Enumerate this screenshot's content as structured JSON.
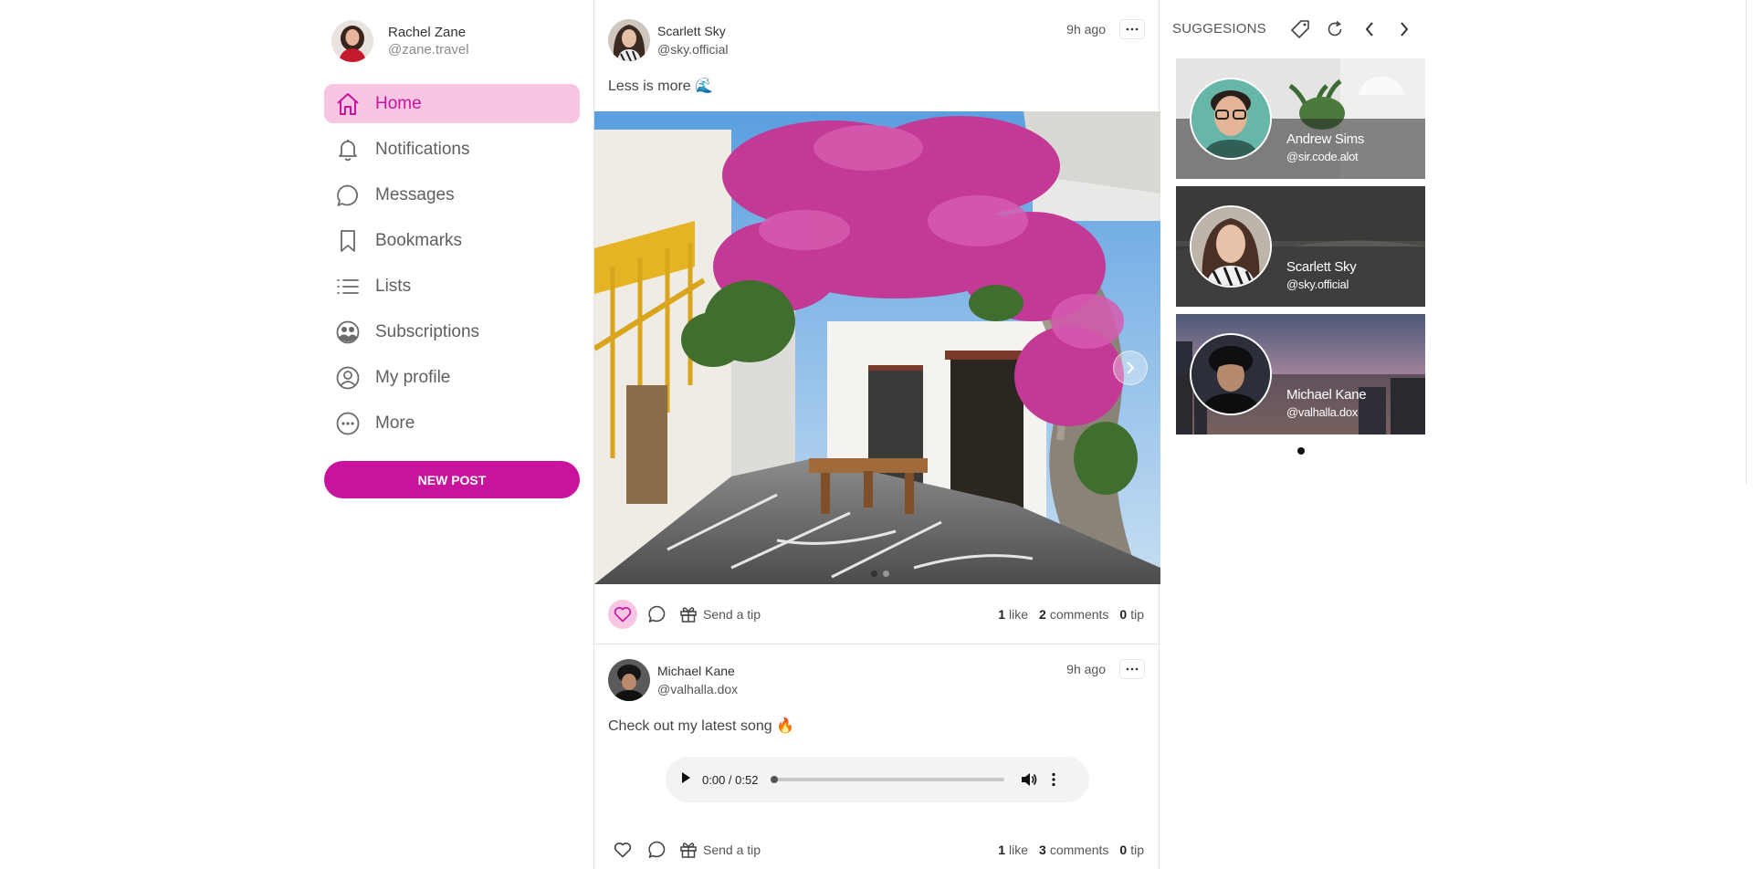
{
  "user": {
    "name": "Rachel Zane",
    "handle": "@zane.travel"
  },
  "nav": {
    "items": [
      {
        "label": "Home",
        "icon": "home-icon",
        "active": true
      },
      {
        "label": "Notifications",
        "icon": "bell-icon",
        "active": false
      },
      {
        "label": "Messages",
        "icon": "chat-bubble-icon",
        "active": false
      },
      {
        "label": "Bookmarks",
        "icon": "bookmark-icon",
        "active": false
      },
      {
        "label": "Lists",
        "icon": "list-icon",
        "active": false
      },
      {
        "label": "Subscriptions",
        "icon": "subscriptions-icon",
        "active": false
      },
      {
        "label": "My profile",
        "icon": "user-circle-icon",
        "active": false
      },
      {
        "label": "More",
        "icon": "more-circle-icon",
        "active": false
      }
    ],
    "new_post_label": "NEW POST"
  },
  "posts": [
    {
      "author": "Scarlett Sky",
      "handle": "@sky.official",
      "time": "9h ago",
      "text": "Less is more 🌊",
      "liked": true,
      "tip_label": "Send a tip",
      "likes": "1",
      "likes_label": "like",
      "comments": "2",
      "comments_label": "comments",
      "tips": "0",
      "tips_label": "tip"
    },
    {
      "author": "Michael Kane",
      "handle": "@valhalla.dox",
      "time": "9h ago",
      "text": "Check out my latest song 🔥",
      "liked": false,
      "audio_time": "0:00 / 0:52",
      "audio_progress": 0,
      "tip_label": "Send a tip",
      "likes": "1",
      "likes_label": "like",
      "comments": "3",
      "comments_label": "comments",
      "tips": "0",
      "tips_label": "tip"
    }
  ],
  "suggestions": {
    "title": "SUGGESIONS",
    "cards": [
      {
        "name": "Andrew Sims",
        "handle": "@sir.code.alot"
      },
      {
        "name": "Scarlett Sky",
        "handle": "@sky.official"
      },
      {
        "name": "Michael Kane",
        "handle": "@valhalla.dox"
      }
    ]
  },
  "colors": {
    "accent": "#c8139c",
    "accent_soft": "#f8c6e3"
  }
}
